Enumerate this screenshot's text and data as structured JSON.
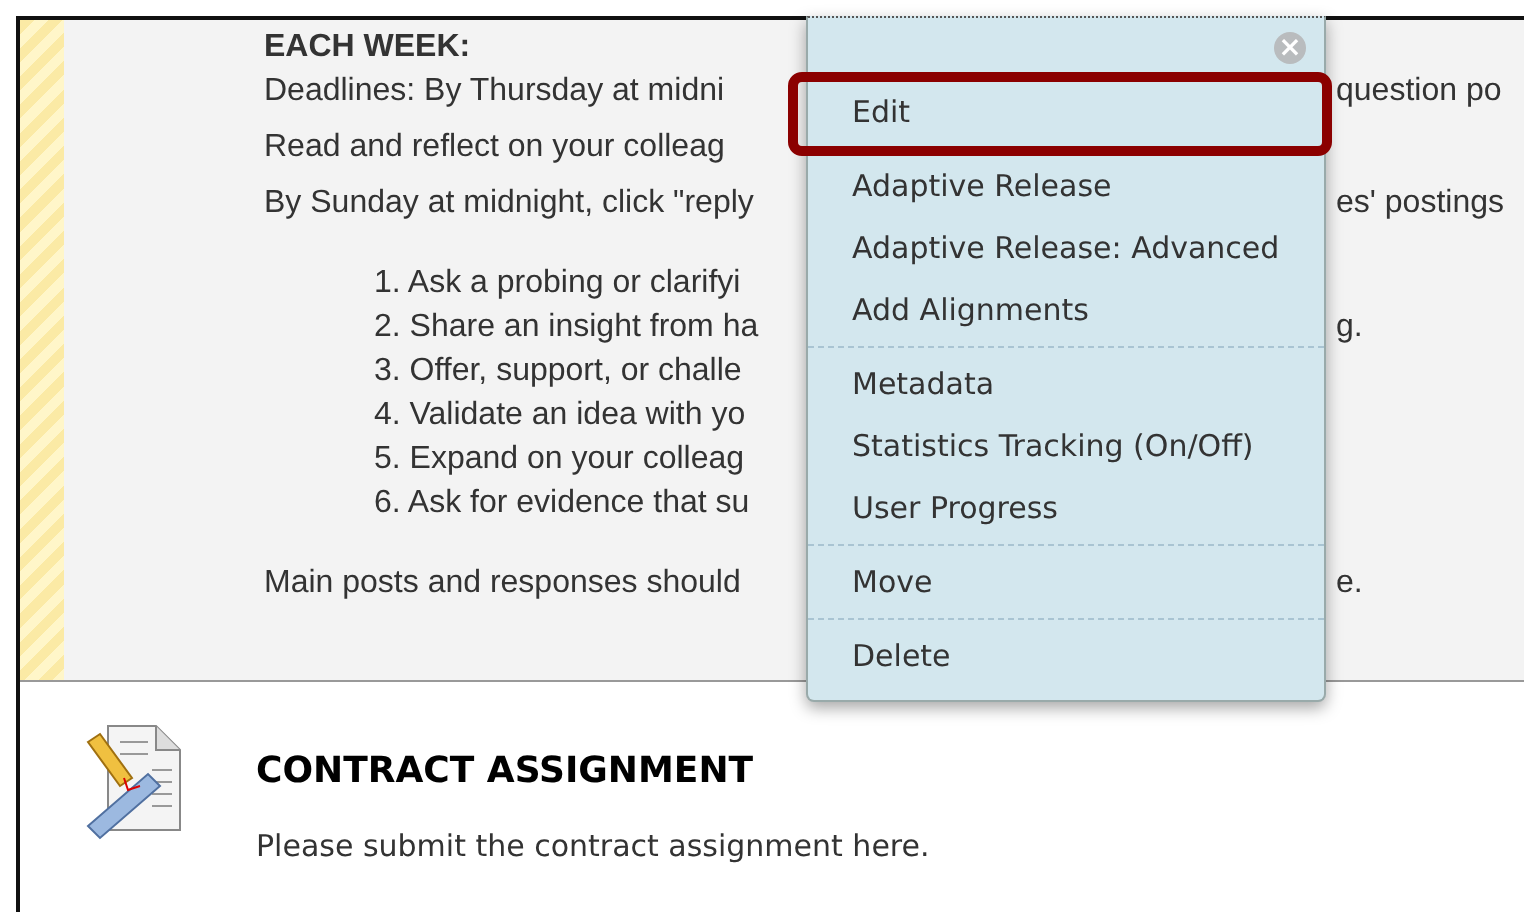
{
  "content_item": {
    "heading": "EACH WEEK:",
    "lines": [
      {
        "left": "Deadlines: By Thursday at midni",
        "right": "question po"
      },
      {
        "left": "Read and reflect on your colleag"
      },
      {
        "left": "By Sunday at midnight, click \"reply",
        "right": "es' postings"
      }
    ],
    "list": [
      {
        "left": "1. Ask a probing or clarifyi"
      },
      {
        "left": "2. Share an insight from ha",
        "right": "g."
      },
      {
        "left": "3. Offer, support, or challe"
      },
      {
        "left": "4. Validate an idea with yo"
      },
      {
        "left": "5. Expand on your colleag"
      },
      {
        "left": "6. Ask for evidence that su"
      }
    ],
    "closing": {
      "left": "Main posts and responses should",
      "right": "e."
    }
  },
  "context_menu": {
    "close": "×",
    "groups": [
      [
        {
          "label": "Edit",
          "selected": true
        }
      ],
      [
        {
          "label": "Adaptive Release",
          "selected": false
        },
        {
          "label": "Adaptive Release: Advanced",
          "selected": false
        },
        {
          "label": "Add Alignments",
          "selected": false
        }
      ],
      [
        {
          "label": "Metadata",
          "selected": false
        },
        {
          "label": "Statistics Tracking (On/Off)",
          "selected": false
        },
        {
          "label": "User Progress",
          "selected": false
        }
      ],
      [
        {
          "label": "Move",
          "selected": false
        }
      ],
      [
        {
          "label": "Delete",
          "selected": false
        }
      ]
    ]
  },
  "assignment": {
    "title": "CONTRACT ASSIGNMENT",
    "description": "Please submit the contract assignment here."
  }
}
